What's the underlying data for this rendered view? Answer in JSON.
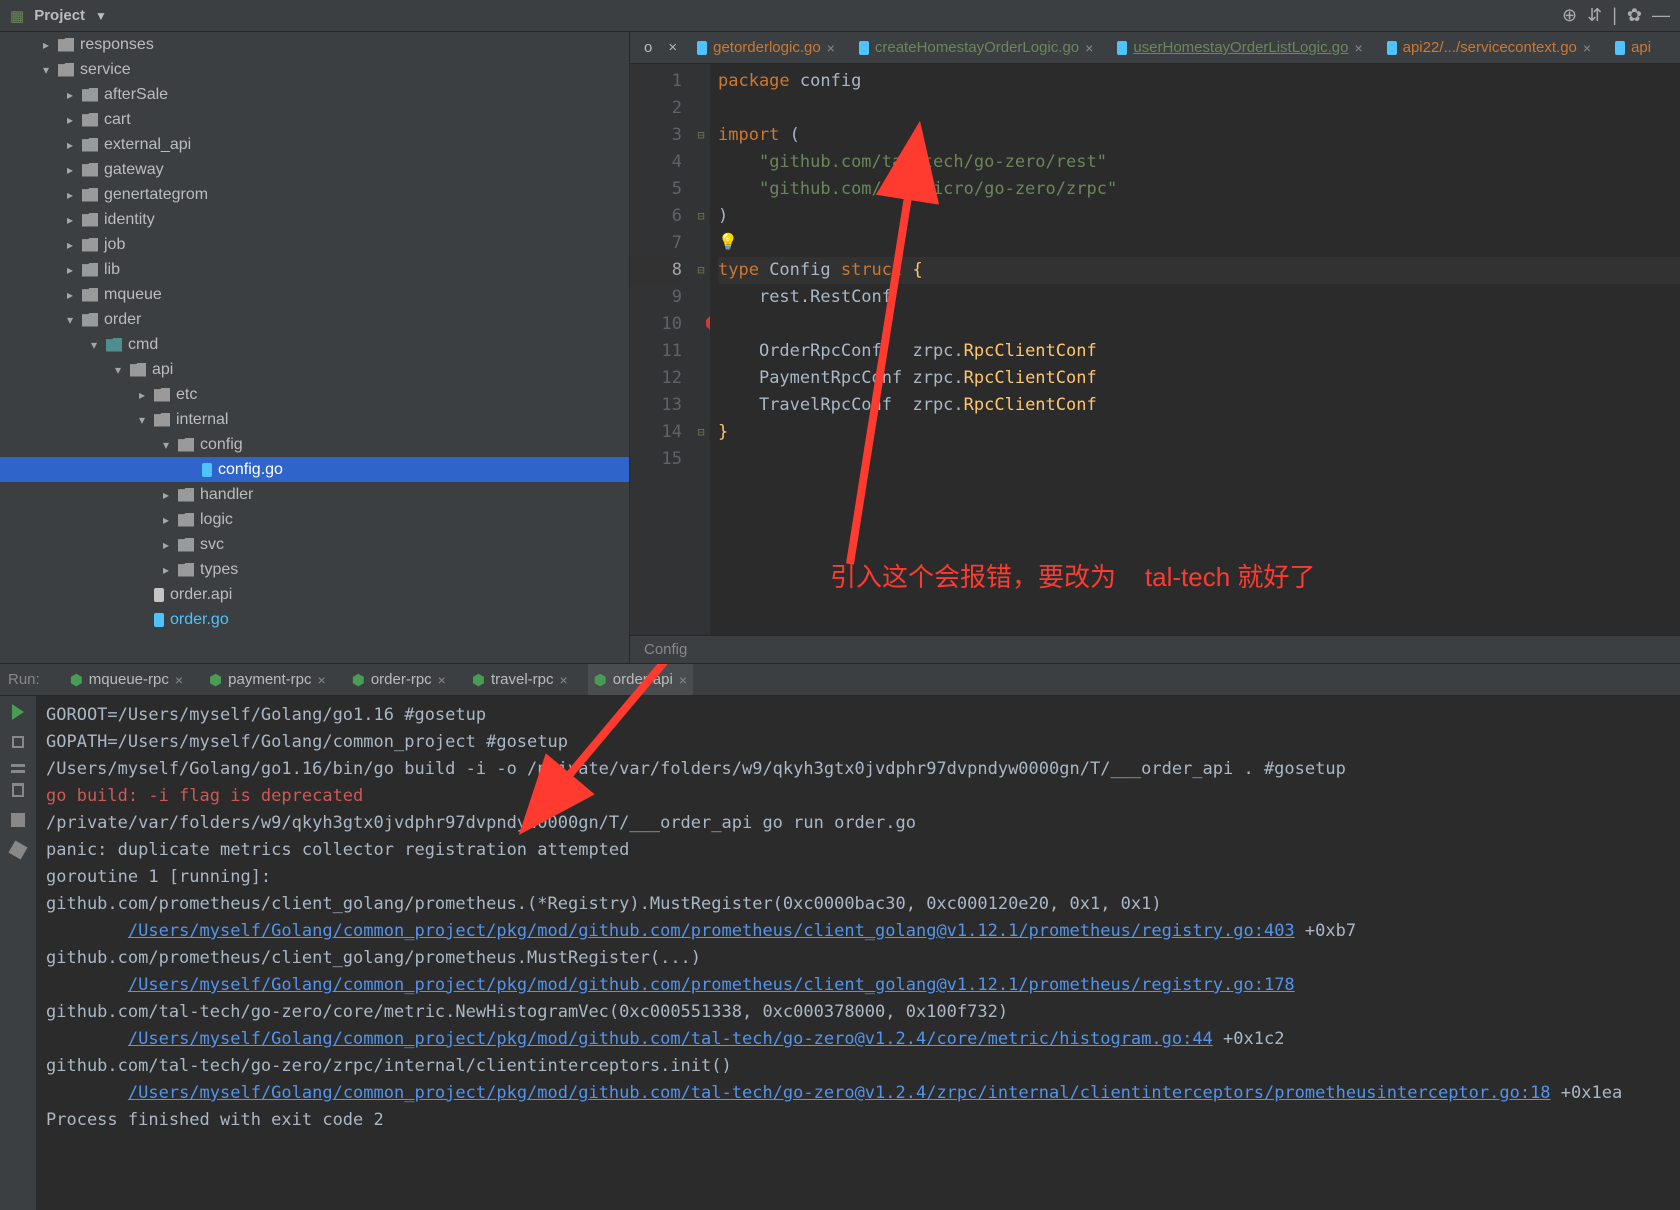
{
  "topbar": {
    "project_label": "Project"
  },
  "tree": {
    "items": [
      {
        "d": 1,
        "arrow": "r",
        "icon": "folder",
        "label": "responses"
      },
      {
        "d": 1,
        "arrow": "d",
        "icon": "folder",
        "label": "service"
      },
      {
        "d": 2,
        "arrow": "r",
        "icon": "folder",
        "label": "afterSale"
      },
      {
        "d": 2,
        "arrow": "r",
        "icon": "folder",
        "label": "cart"
      },
      {
        "d": 2,
        "arrow": "r",
        "icon": "folder",
        "label": "external_api"
      },
      {
        "d": 2,
        "arrow": "r",
        "icon": "folder",
        "label": "gateway"
      },
      {
        "d": 2,
        "arrow": "r",
        "icon": "folder",
        "label": "genertategrom"
      },
      {
        "d": 2,
        "arrow": "r",
        "icon": "folder",
        "label": "identity"
      },
      {
        "d": 2,
        "arrow": "r",
        "icon": "folder",
        "label": "job"
      },
      {
        "d": 2,
        "arrow": "r",
        "icon": "folder",
        "label": "lib"
      },
      {
        "d": 2,
        "arrow": "r",
        "icon": "folder",
        "label": "mqueue"
      },
      {
        "d": 2,
        "arrow": "d",
        "icon": "folder",
        "label": "order"
      },
      {
        "d": 3,
        "arrow": "d",
        "icon": "folder-teal",
        "label": "cmd"
      },
      {
        "d": 4,
        "arrow": "d",
        "icon": "folder",
        "label": "api"
      },
      {
        "d": 5,
        "arrow": "r",
        "icon": "folder",
        "label": "etc"
      },
      {
        "d": 5,
        "arrow": "d",
        "icon": "folder",
        "label": "internal"
      },
      {
        "d": 6,
        "arrow": "d",
        "icon": "folder",
        "label": "config"
      },
      {
        "d": 7,
        "arrow": "",
        "icon": "go",
        "label": "config.go",
        "selected": true
      },
      {
        "d": 6,
        "arrow": "r",
        "icon": "folder",
        "label": "handler"
      },
      {
        "d": 6,
        "arrow": "r",
        "icon": "folder",
        "label": "logic"
      },
      {
        "d": 6,
        "arrow": "r",
        "icon": "folder",
        "label": "svc"
      },
      {
        "d": 6,
        "arrow": "r",
        "icon": "folder",
        "label": "types"
      },
      {
        "d": 5,
        "arrow": "",
        "icon": "api",
        "label": "order.api"
      },
      {
        "d": 5,
        "arrow": "",
        "icon": "go",
        "label": "order.go"
      }
    ]
  },
  "editor_tabs": {
    "prefix_stub": "o",
    "items": [
      {
        "label": "getorderlogic.go",
        "color": "orange"
      },
      {
        "label": "createHomestayOrderLogic.go",
        "color": "green"
      },
      {
        "label": "userHomestayOrderListLogic.go",
        "color": "green",
        "underline": true
      },
      {
        "label": "api22/.../servicecontext.go",
        "color": "orange"
      },
      {
        "label": "api",
        "color": "orange",
        "truncated": true
      }
    ]
  },
  "code": {
    "lines": [
      {
        "n": "1",
        "seg": [
          [
            "kw",
            "package "
          ],
          [
            "id",
            "config"
          ]
        ]
      },
      {
        "n": "2",
        "seg": []
      },
      {
        "n": "3",
        "fold": "-",
        "seg": [
          [
            "kw",
            "import "
          ],
          [
            "id",
            "("
          ]
        ]
      },
      {
        "n": "4",
        "seg": [
          [
            "",
            "    "
          ],
          [
            "imp",
            "\"github.com/tal-tech/go-zero/rest\""
          ]
        ]
      },
      {
        "n": "5",
        "seg": [
          [
            "",
            "    "
          ],
          [
            "imp",
            "\"github.com/zeromicro/go-zero/zrpc\""
          ]
        ]
      },
      {
        "n": "6",
        "fold": "-",
        "seg": [
          [
            "id",
            ")"
          ]
        ]
      },
      {
        "n": "7",
        "seg": []
      },
      {
        "n": "8",
        "hl": true,
        "fold": "-",
        "seg": [
          [
            "kw",
            "type "
          ],
          [
            "id",
            "Config "
          ],
          [
            "kw",
            "struct "
          ],
          [
            "br",
            "{"
          ]
        ]
      },
      {
        "n": "9",
        "seg": [
          [
            "",
            "    "
          ],
          [
            "id",
            "rest.RestConf"
          ]
        ]
      },
      {
        "n": "10",
        "seg": []
      },
      {
        "n": "11",
        "seg": [
          [
            "",
            "    "
          ],
          [
            "id",
            "OrderRpcConf   zrpc."
          ],
          [
            "typ",
            "RpcClientConf"
          ]
        ]
      },
      {
        "n": "12",
        "seg": [
          [
            "",
            "    "
          ],
          [
            "id",
            "PaymentRpcConf zrpc."
          ],
          [
            "typ",
            "RpcClientConf"
          ]
        ]
      },
      {
        "n": "13",
        "seg": [
          [
            "",
            "    "
          ],
          [
            "id",
            "TravelRpcConf  zrpc."
          ],
          [
            "typ",
            "RpcClientConf"
          ]
        ]
      },
      {
        "n": "14",
        "fold": "-",
        "seg": [
          [
            "br",
            "}"
          ]
        ]
      },
      {
        "n": "15",
        "seg": []
      }
    ]
  },
  "crumb": "Config",
  "annotation": {
    "text_1": "引入这个会报错，要改为",
    "text_2": "tal-tech 就好了"
  },
  "run_tabs": {
    "label": "Run:",
    "items": [
      {
        "label": "mqueue-rpc"
      },
      {
        "label": "payment-rpc"
      },
      {
        "label": "order-rpc"
      },
      {
        "label": "travel-rpc"
      },
      {
        "label": "order-api",
        "active": true
      }
    ]
  },
  "console": {
    "lines": [
      "GOROOT=/Users/myself/Golang/go1.16 #gosetup",
      "GOPATH=/Users/myself/Golang/common_project #gosetup",
      "/Users/myself/Golang/go1.16/bin/go build -i -o /private/var/folders/w9/qkyh3gtx0jvdphr97dvpndyw0000gn/T/___order_api . #gosetup",
      {
        "text": "go build: -i flag is deprecated",
        "cls": "err"
      },
      "/private/var/folders/w9/qkyh3gtx0jvdphr97dvpndyw0000gn/T/___order_api go run order.go",
      "panic: duplicate metrics collector registration attempted",
      "",
      "goroutine 1 [running]:",
      "github.com/prometheus/client_golang/prometheus.(*Registry).MustRegister(0xc0000bac30, 0xc000120e20, 0x1, 0x1)",
      {
        "link": "/Users/myself/Golang/common_project/pkg/mod/github.com/prometheus/client_golang@v1.12.1/prometheus/registry.go:403",
        "suffix": " +0xb7"
      },
      "github.com/prometheus/client_golang/prometheus.MustRegister(...)",
      {
        "link": "/Users/myself/Golang/common_project/pkg/mod/github.com/prometheus/client_golang@v1.12.1/prometheus/registry.go:178",
        "suffix": ""
      },
      "github.com/tal-tech/go-zero/core/metric.NewHistogramVec(0xc000551338, 0xc000378000, 0x100f732)",
      {
        "link": "/Users/myself/Golang/common_project/pkg/mod/github.com/tal-tech/go-zero@v1.2.4/core/metric/histogram.go:44",
        "suffix": " +0x1c2"
      },
      "github.com/tal-tech/go-zero/zrpc/internal/clientinterceptors.init()",
      {
        "link": "/Users/myself/Golang/common_project/pkg/mod/github.com/tal-tech/go-zero@v1.2.4/zrpc/internal/clientinterceptors/prometheusinterceptor.go:18",
        "suffix": " +0x1ea"
      },
      "",
      "Process finished with exit code 2"
    ]
  }
}
